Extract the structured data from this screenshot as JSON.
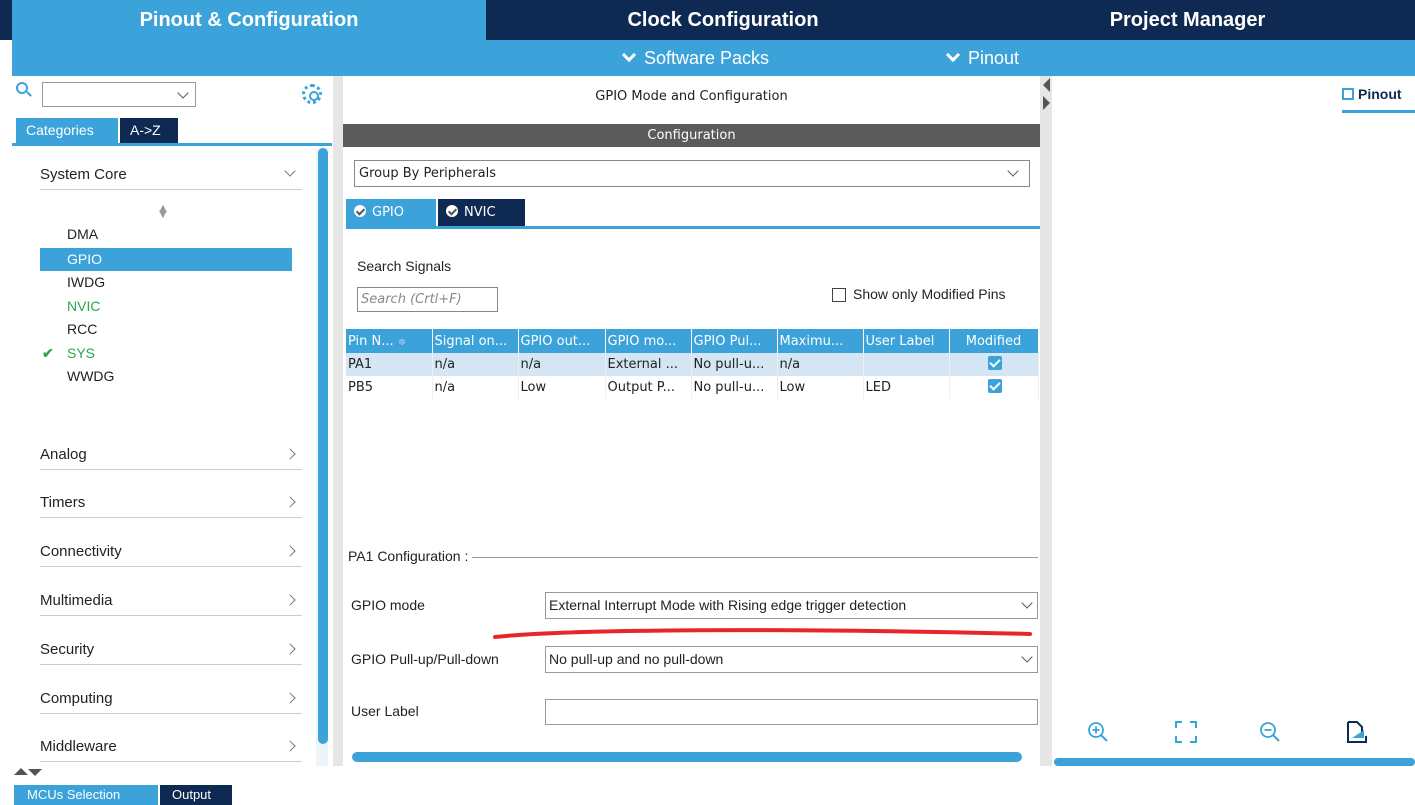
{
  "top_tabs": {
    "pinout": "Pinout & Configuration",
    "clock": "Clock Configuration",
    "project": "Project Manager"
  },
  "sub_bar": {
    "software_packs": "Software Packs",
    "pinout": "Pinout"
  },
  "left_panel": {
    "tabs": {
      "categories": "Categories",
      "az": "A->Z"
    },
    "groups": {
      "system_core": "System Core",
      "analog": "Analog",
      "timers": "Timers",
      "connectivity": "Connectivity",
      "multimedia": "Multimedia",
      "security": "Security",
      "computing": "Computing",
      "middleware": "Middleware"
    },
    "core_items": [
      "DMA",
      "GPIO",
      "IWDG",
      "NVIC",
      "RCC",
      "SYS",
      "WWDG"
    ],
    "selected_item": "GPIO",
    "check_glyph": "✔"
  },
  "middle": {
    "header": "GPIO Mode and Configuration",
    "config_bar": "Configuration",
    "group_by": "Group By Peripherals",
    "tabs": {
      "gpio": "GPIO",
      "nvic": "NVIC"
    },
    "search_label": "Search Signals",
    "search_placeholder": "Search (Crtl+F)",
    "show_modified": "Show only Modified Pins",
    "table": {
      "headers": [
        "Pin N...",
        "Signal on...",
        "GPIO out...",
        "GPIO mo...",
        "GPIO Pul...",
        "Maximu...",
        "User Label",
        "Modified"
      ],
      "rows": [
        [
          "PA1",
          "n/a",
          "n/a",
          "External ...",
          "No pull-u...",
          "n/a",
          "",
          true
        ],
        [
          "PB5",
          "n/a",
          "Low",
          "Output P...",
          "No pull-u...",
          "Low",
          "LED",
          true
        ]
      ],
      "sort_glyph": "≑"
    },
    "pa1_config": {
      "title": "PA1 Configuration :",
      "gpio_mode_label": "GPIO mode",
      "gpio_mode_value": "External Interrupt Mode with Rising edge trigger detection",
      "pull_label": "GPIO Pull-up/Pull-down",
      "pull_value": "No pull-up and no pull-down",
      "user_label_label": "User Label",
      "user_label_value": ""
    }
  },
  "right_panel": {
    "view_tab": "Pinout"
  },
  "bottom_tabs": {
    "mcu": "MCUs Selection",
    "output": "Output"
  },
  "colors": {
    "accent": "#3ba3da",
    "dark": "#0f2a52",
    "green": "#2aa84a",
    "annotation": "#e8262a"
  }
}
